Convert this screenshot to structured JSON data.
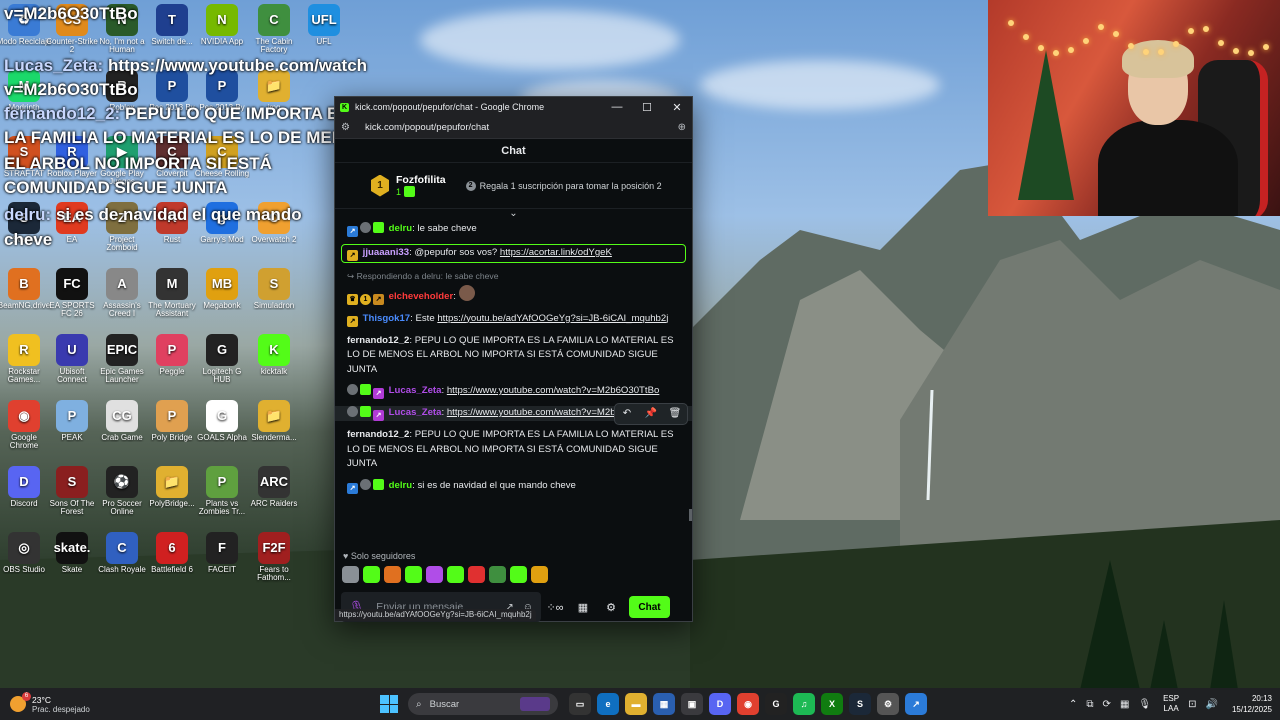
{
  "desktop": {
    "icons": [
      {
        "label": "Modo Reciclaje",
        "glyph": "♻",
        "color": "#3a7bd5"
      },
      {
        "label": "Counter-Strike 2",
        "glyph": "CS",
        "color": "#e08a1c"
      },
      {
        "label": "No, I'm not a Human",
        "glyph": "N",
        "color": "#2a5a2a"
      },
      {
        "label": "Switch de...",
        "glyph": "T",
        "color": "#1f3f8f"
      },
      {
        "label": "NVIDIA App",
        "glyph": "N",
        "color": "#76b900"
      },
      {
        "label": "The Cabin Factory",
        "glyph": "C",
        "color": "#3f8f3f"
      },
      {
        "label": "UFL",
        "glyph": "UFL",
        "color": "#1f8fe0"
      },
      {
        "label": "Modrinth",
        "glyph": "M",
        "color": "#1bd96a"
      },
      {
        "label": "Roblox",
        "glyph": "R",
        "color": "#222"
      },
      {
        "label": "Pes 2013 By",
        "glyph": "P",
        "color": "#1f4f9f"
      },
      {
        "label": "Pes 2013 By",
        "glyph": "P",
        "color": "#1f4f9f"
      },
      {
        "label": "img",
        "glyph": "📁",
        "color": "#e0b030"
      },
      {
        "label": "STRAFTAT",
        "glyph": "S",
        "color": "#d0501f"
      },
      {
        "label": "Roblox Player",
        "glyph": "R",
        "color": "#3060e0"
      },
      {
        "label": "Google Play Juegos",
        "glyph": "▶",
        "color": "#1f9f6f"
      },
      {
        "label": "Cloverpit",
        "glyph": "C",
        "color": "#5f2f2f"
      },
      {
        "label": "Cheese Rolling",
        "glyph": "C",
        "color": "#d0a020"
      },
      {
        "label": "Steam",
        "glyph": "S",
        "color": "#1b2838"
      },
      {
        "label": "EA",
        "glyph": "EA",
        "color": "#e03a1f"
      },
      {
        "label": "Project Zomboid",
        "glyph": "Z",
        "color": "#7f6f3f"
      },
      {
        "label": "Rust",
        "glyph": "R",
        "color": "#c0392b"
      },
      {
        "label": "Garry's Mod",
        "glyph": "g",
        "color": "#1f6fe0"
      },
      {
        "label": "Overwatch 2",
        "glyph": "O",
        "color": "#f0a030"
      },
      {
        "label": "BeamNG.drive",
        "glyph": "B",
        "color": "#e07020"
      },
      {
        "label": "EA SPORTS FC 26",
        "glyph": "FC",
        "color": "#111"
      },
      {
        "label": "Assassin's Creed I",
        "glyph": "A",
        "color": "#888"
      },
      {
        "label": "The Mortuary Assistant",
        "glyph": "M",
        "color": "#333"
      },
      {
        "label": "Megabonk",
        "glyph": "MB",
        "color": "#e0a010"
      },
      {
        "label": "Simuladron",
        "glyph": "S",
        "color": "#d0a030"
      },
      {
        "label": "Rockstar Games...",
        "glyph": "R",
        "color": "#f0c020"
      },
      {
        "label": "Ubisoft Connect",
        "glyph": "U",
        "color": "#3a3aaf"
      },
      {
        "label": "Epic Games Launcher",
        "glyph": "EPIC",
        "color": "#222"
      },
      {
        "label": "Peggle",
        "glyph": "P",
        "color": "#e04060"
      },
      {
        "label": "Logitech G HUB",
        "glyph": "G",
        "color": "#222"
      },
      {
        "label": "kicktalk",
        "glyph": "K",
        "color": "#53fc18"
      },
      {
        "label": "Google Chrome",
        "glyph": "◉",
        "color": "#e0402f"
      },
      {
        "label": "PEAK",
        "glyph": "P",
        "color": "#7fb0e0"
      },
      {
        "label": "Crab Game",
        "glyph": "CG",
        "color": "#e0e0e0"
      },
      {
        "label": "Poly Bridge",
        "glyph": "P",
        "color": "#e0a050"
      },
      {
        "label": "GOALS Alpha",
        "glyph": "G",
        "color": "#fff"
      },
      {
        "label": "Slenderma...",
        "glyph": "📁",
        "color": "#e0b030"
      },
      {
        "label": "Discord",
        "glyph": "D",
        "color": "#5865f2"
      },
      {
        "label": "Sons Of The Forest",
        "glyph": "S",
        "color": "#8a1f1f"
      },
      {
        "label": "Pro Soccer Online",
        "glyph": "⚽",
        "color": "#222"
      },
      {
        "label": "PolyBridge...",
        "glyph": "📁",
        "color": "#e0b030"
      },
      {
        "label": "Plants vs Zombies Tr...",
        "glyph": "P",
        "color": "#5fa03f"
      },
      {
        "label": "ARC Raiders",
        "glyph": "ARC",
        "color": "#333"
      },
      {
        "label": "OBS Studio",
        "glyph": "◎",
        "color": "#333"
      },
      {
        "label": "Skate",
        "glyph": "skate.",
        "color": "#111"
      },
      {
        "label": "Clash Royale",
        "glyph": "C",
        "color": "#3060c0"
      },
      {
        "label": "Battlefield 6",
        "glyph": "6",
        "color": "#d02020"
      },
      {
        "label": "FACEIT",
        "glyph": "F",
        "color": "#222"
      },
      {
        "label": "Fears to Fathom...",
        "glyph": "F2F",
        "color": "#a01f1f"
      }
    ]
  },
  "overlay": {
    "lines": [
      {
        "who": "",
        "text": "v=M2b6O30TtBo"
      },
      {
        "who": "Lucas_Zeta:",
        "text": "https://www.youtube.com/watch"
      },
      {
        "who": "",
        "text": "v=M2b6O30TtBo"
      },
      {
        "who": "fernando12_2:",
        "text": "PEPU LO QUE IMPORTA ES"
      },
      {
        "who": "",
        "text": "LA FAMILIA LO MATERIAL ES LO DE MENOS"
      },
      {
        "who": "",
        "text": "EL ARBOL NO IMPORTA SI ESTÁ"
      },
      {
        "who": "",
        "text": "COMUNIDAD SIGUE JUNTA"
      },
      {
        "who": "delru:",
        "text": "si es de navidad el que mando"
      },
      {
        "who": "",
        "text": "cheve"
      }
    ]
  },
  "browser": {
    "title": "kick.com/popout/pepufor/chat - Google Chrome",
    "url": "kick.com/popout/pepufor/chat",
    "status_url": "https://youtu.be/adYAfOOGeYg?si=JB-6iCAI_mquhb2j"
  },
  "chat": {
    "header": "Chat",
    "pinned": {
      "rank": "1",
      "name": "Fozfofilita",
      "count": "1",
      "gift_text": "Regala 1 suscripción para tomar la posición 2",
      "gift_num": "2"
    },
    "messages": [
      {
        "user": "delru",
        "color": "#53fc18",
        "text": "le sabe cheve"
      },
      {
        "user": "jjuaaani33",
        "color": "#c9a0ff",
        "text": "@pepufor sos vos?",
        "link": "https://acortar.link/odYgeK"
      },
      {
        "reply": "Respondiendo a delru: le sabe cheve",
        "user": "elcheveholder",
        "color": "#ff3b3b"
      },
      {
        "user": "Thisgok17",
        "color": "#4a8cff",
        "text": "Este",
        "link": "https://youtu.be/adYAfOOGeYg?si=JB-6iCAI_mquhb2j"
      },
      {
        "user": "fernando12_2",
        "color": "#e8eaed",
        "text": "PEPU LO QUE IMPORTA ES LA FAMILIA LO MATERIAL ES LO DE MENOS EL ARBOL NO IMPORTA SI ESTÁ COMUNIDAD SIGUE JUNTA"
      },
      {
        "user": "Lucas_Zeta",
        "color": "#b04de8",
        "link": "https://www.youtube.com/watch?v=M2b6O30TtBo"
      },
      {
        "user": "Lucas_Zeta",
        "color": "#b04de8",
        "link": "https://www.youtube.com/watch?v=M2b6O30TtBo"
      },
      {
        "user": "fernando12_2",
        "color": "#e8eaed",
        "text": "PEPU LO QUE IMPORTA ES LA FAMILIA LO MATERIAL ES LO DE MENOS EL ARBOL NO IMPORTA SI ESTÁ COMUNIDAD SIGUE JUNTA"
      },
      {
        "user": "delru",
        "color": "#53fc18",
        "text": "si es de navidad el que mando cheve"
      }
    ],
    "followers_only": "Solo seguidores",
    "input_placeholder": "Enviar un mensaje",
    "send_label": "Chat",
    "emote_colors": [
      "#8a9096",
      "#53fc18",
      "#e07020",
      "#53fc18",
      "#b04de8",
      "#53fc18",
      "#e03030",
      "#3f8f3f",
      "#53fc18",
      "#e0a010"
    ]
  },
  "taskbar": {
    "temp": "23°C",
    "weather": "Prac. despejado",
    "weather_badge": "6",
    "search_placeholder": "Buscar",
    "lang_top": "ESP",
    "lang_bottom": "LAA",
    "time": "20:13",
    "date": "15/12/2025"
  }
}
